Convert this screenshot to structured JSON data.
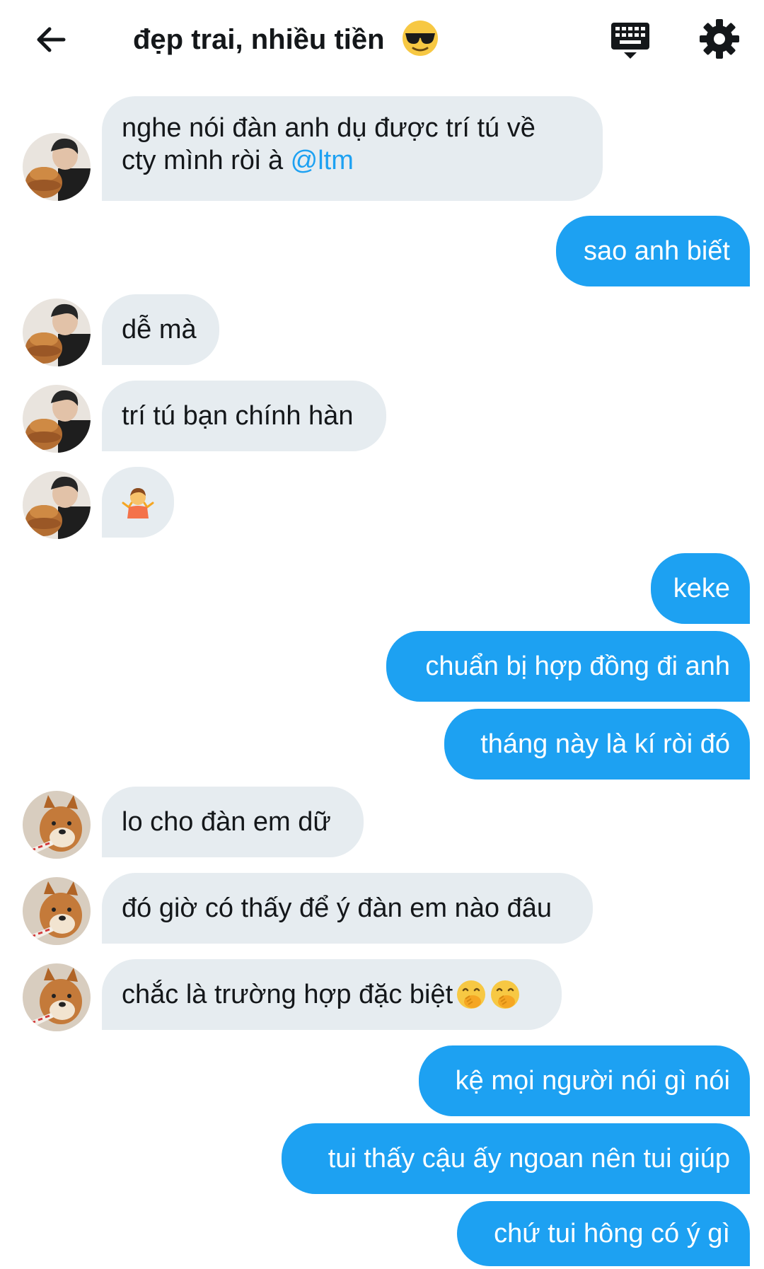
{
  "header": {
    "title": "đẹp trai, nhiều tiền",
    "title_emoji": "sunglasses-face",
    "back_icon": "arrow-left-icon",
    "keyboard_icon": "keyboard-icon",
    "settings_icon": "gear-icon"
  },
  "messages": [
    {
      "dir": "in",
      "sender": "person",
      "line1": "nghe nói đàn anh dụ được trí tú về",
      "line2_text": "cty mình ròi à ",
      "mention": "@ltm"
    },
    {
      "dir": "out",
      "text": "sao anh biết"
    },
    {
      "dir": "in",
      "sender": "person",
      "text": "dễ mà"
    },
    {
      "dir": "in",
      "sender": "person",
      "text": "trí tú bạn chính hàn"
    },
    {
      "dir": "in",
      "sender": "person",
      "emoji": "person-shrugging"
    },
    {
      "dir": "out",
      "text": "keke"
    },
    {
      "dir": "out",
      "text": "chuẩn bị hợp đồng đi anh"
    },
    {
      "dir": "out",
      "text": "tháng này là kí ròi đó"
    },
    {
      "dir": "in",
      "sender": "dog",
      "text": "lo cho đàn em dữ"
    },
    {
      "dir": "in",
      "sender": "dog",
      "text": "đó giờ có thấy để ý đàn em nào đâu"
    },
    {
      "dir": "in",
      "sender": "dog",
      "text": "chắc là trường hợp đặc biệt ",
      "emoji": "face-hand-over-mouth x2"
    },
    {
      "dir": "out",
      "text": "kệ mọi người nói gì nói"
    },
    {
      "dir": "out",
      "text": "tui thấy cậu ấy ngoan nên tui giúp"
    },
    {
      "dir": "out",
      "text": "chứ tui hông có ý gì"
    }
  ],
  "colors": {
    "incoming_bubble": "#e6ecf0",
    "outgoing_bubble": "#1da1f2",
    "mention": "#1da1f2",
    "text": "#14171a"
  }
}
